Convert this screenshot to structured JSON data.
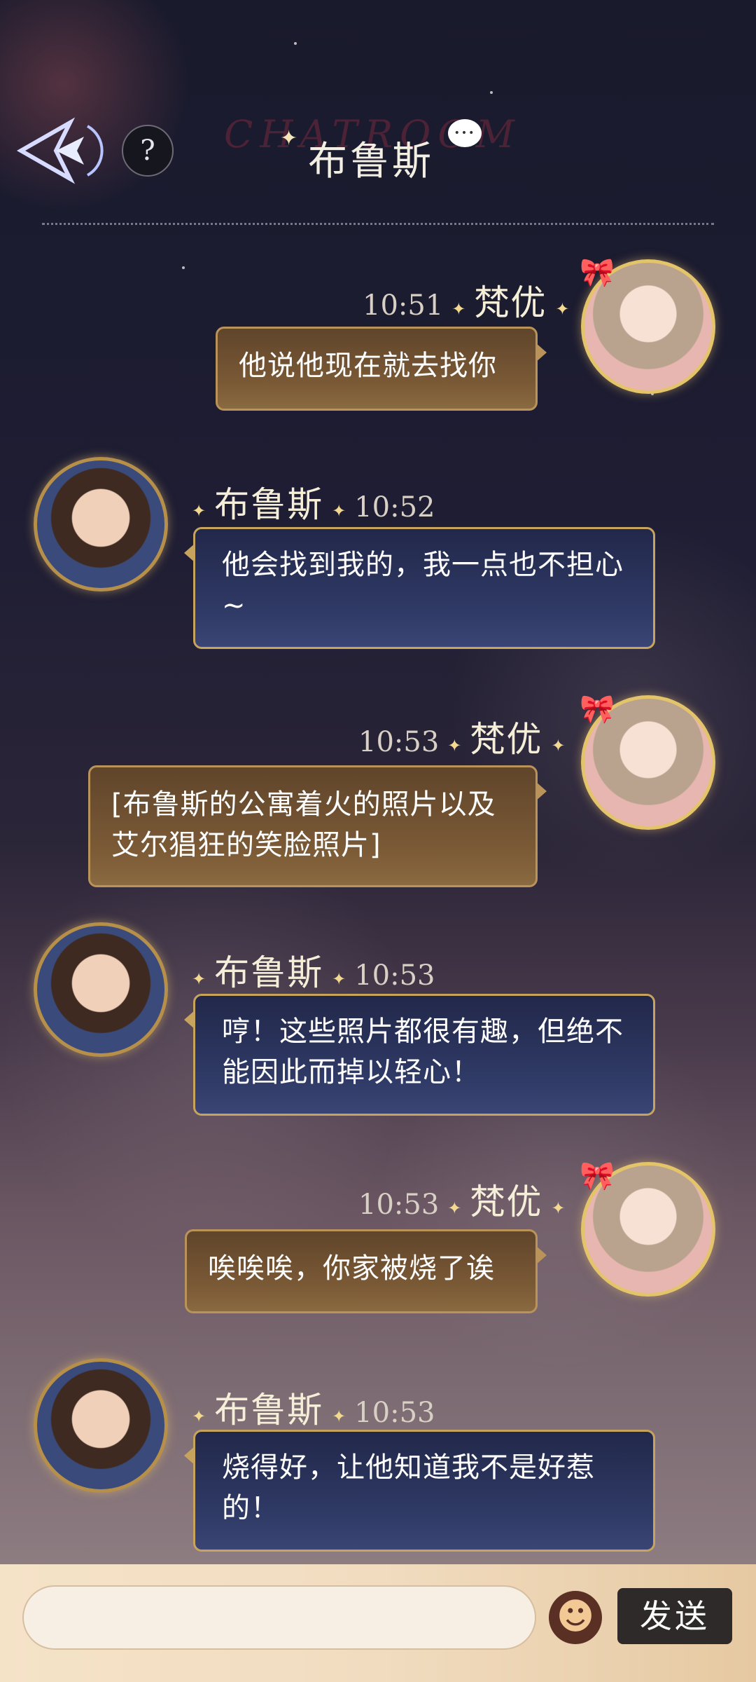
{
  "header": {
    "title": "布鲁斯",
    "watermark": "CHATROOM",
    "help_label": "?"
  },
  "messages": [
    {
      "sender": "梵优",
      "time": "10:51",
      "text": "他说他现在就去找你"
    },
    {
      "sender": "布鲁斯",
      "time": "10:52",
      "text": "他会找到我的，我一点也不担心~"
    },
    {
      "sender": "梵优",
      "time": "10:53",
      "text": "[布鲁斯的公寓着火的照片以及艾尔猖狂的笑脸照片]"
    },
    {
      "sender": "布鲁斯",
      "time": "10:53",
      "text": "哼！这些照片都很有趣，但绝不能因此而掉以轻心！"
    },
    {
      "sender": "梵优",
      "time": "10:53",
      "text": "唉唉唉，你家被烧了诶"
    },
    {
      "sender": "布鲁斯",
      "time": "10:53",
      "text": "烧得好，让他知道我不是好惹的！"
    }
  ],
  "input_bar": {
    "placeholder": "",
    "send_label": "发送",
    "emoji_icon": "☻"
  }
}
